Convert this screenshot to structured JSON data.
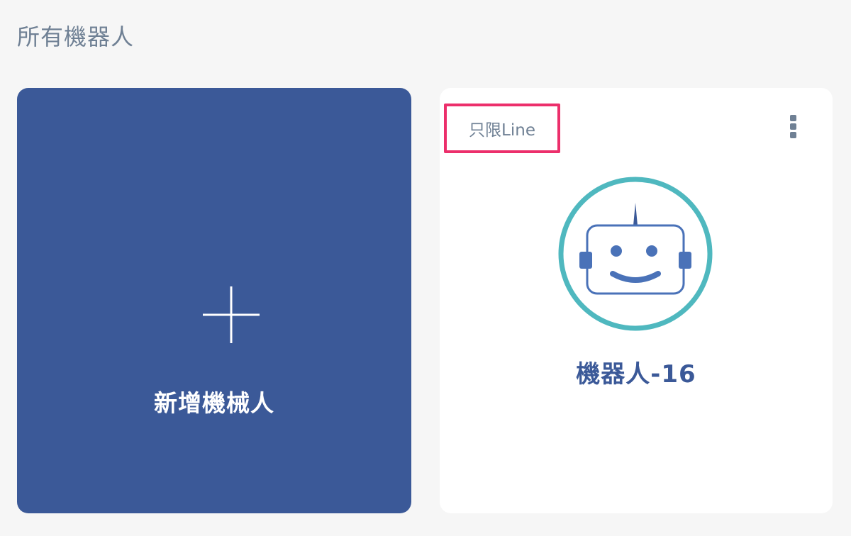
{
  "header": {
    "title": "所有機器人"
  },
  "add_card": {
    "label": "新增機械人",
    "icon": "plus-icon",
    "background": "#3b5998"
  },
  "bots": [
    {
      "name": "機器人-16",
      "channel_badge": "只限Line",
      "badge_color": "#ec2f6b",
      "avatar_icon": "robot-face-icon",
      "avatar_ring_color": "#4fb8bf",
      "menu_icon": "more-vertical-icon"
    }
  ]
}
